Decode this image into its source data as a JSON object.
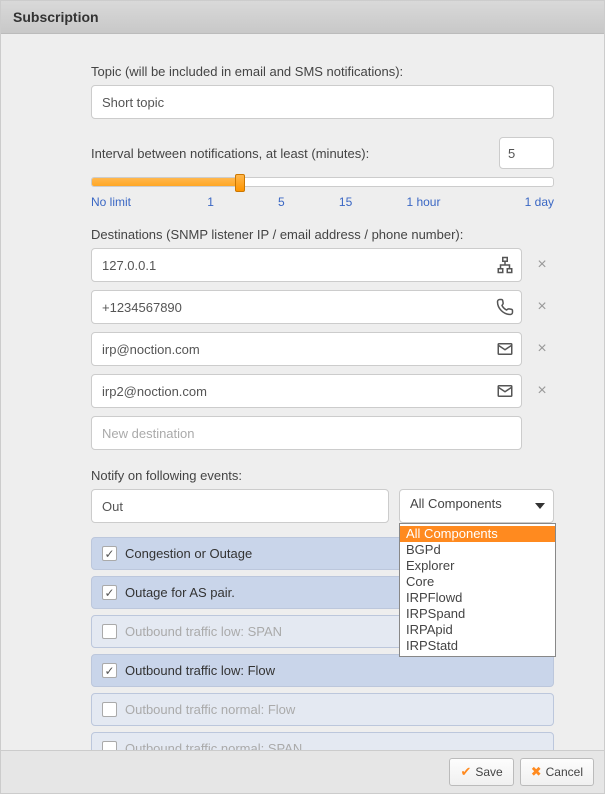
{
  "title": "Subscription",
  "labels": {
    "topic": "Topic (will be included in email and SMS notifications):",
    "interval": "Interval between notifications, at least (minutes):",
    "destinations": "Destinations (SNMP listener IP / email address / phone number):",
    "events": "Notify on following events:"
  },
  "topic_value": "Short topic",
  "interval_value": "5",
  "slider_ticks": [
    "No limit",
    "1",
    "5",
    "15",
    "1 hour",
    "1 day"
  ],
  "destinations": [
    {
      "value": "127.0.0.1",
      "icon": "network-icon"
    },
    {
      "value": "+1234567890",
      "icon": "phone-icon"
    },
    {
      "value": "irp@noction.com",
      "icon": "mail-icon"
    },
    {
      "value": "irp2@noction.com",
      "icon": "mail-icon"
    }
  ],
  "new_destination_placeholder": "New destination",
  "filter_text": "Out",
  "dropdown_selected": "All Components",
  "dropdown_options": [
    "All Components",
    "BGPd",
    "Explorer",
    "Core",
    "IRPFlowd",
    "IRPSpand",
    "IRPApid",
    "IRPStatd"
  ],
  "events": [
    {
      "label": "Congestion or Outage",
      "checked": true
    },
    {
      "label": "Outage for AS pair.",
      "checked": true
    },
    {
      "label": "Outbound traffic low: SPAN",
      "checked": false
    },
    {
      "label": "Outbound traffic low: Flow",
      "checked": true
    },
    {
      "label": "Outbound traffic normal: Flow",
      "checked": false
    },
    {
      "label": "Outbound traffic normal: SPAN",
      "checked": false
    }
  ],
  "buttons": {
    "save": "Save",
    "cancel": "Cancel"
  }
}
